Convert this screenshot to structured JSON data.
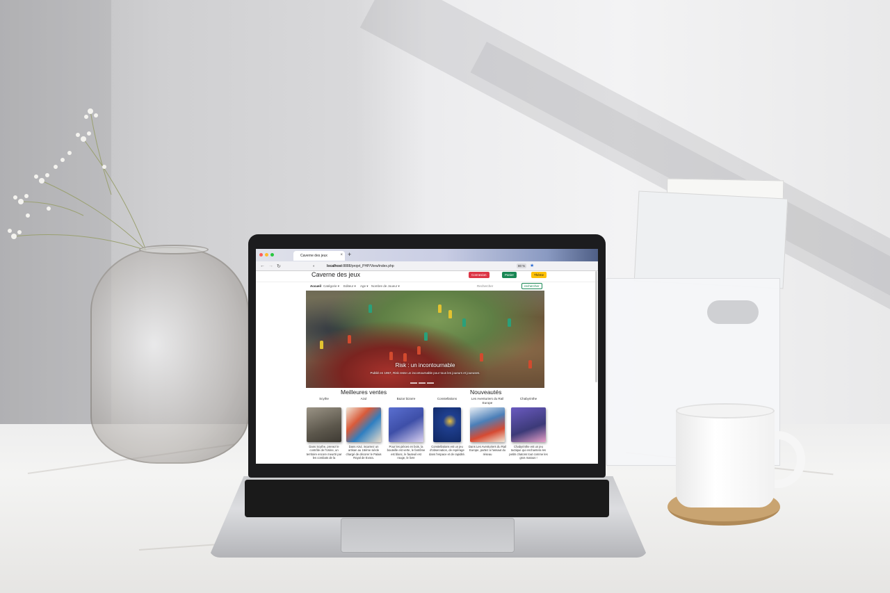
{
  "browser": {
    "tab_title": "Caverne des jeux",
    "tab_close": "×",
    "tab_new": "+",
    "url_prefix": "localhost",
    "url_rest": ":8888/projet_PHP/View/index.php",
    "zoom": "80 %"
  },
  "site": {
    "brand": "Caverne des jeux",
    "buttons": {
      "login": "Connexion",
      "cart": "Panier",
      "theme": "Thème"
    },
    "nav": [
      {
        "label": "Accueil",
        "active": true
      },
      {
        "label": "Catégorie ▾"
      },
      {
        "label": "Editeur ▾"
      },
      {
        "label": "Age ▾"
      },
      {
        "label": "Nombre de Joueur ▾"
      }
    ],
    "search_placeholder": "Rechercher",
    "search_button": "rechercher"
  },
  "carousel": {
    "title": "Risk : un incontournable",
    "subtitle": "Publié en 1957, Risk reste un incontournable pour tous les joueurs et joueuses."
  },
  "sections": {
    "best_sellers": "Meilleures ventes",
    "new_arrivals": "Nouveautés"
  },
  "products": [
    {
      "name": "Scythe",
      "desc": "Dans Scythe, prenez le contrôle de l'Usine, un territoire encore meurtri par les combats de la",
      "color": "#6f6a5e"
    },
    {
      "name": "Azul",
      "desc": "Dans Azul, incarnez un artisan au 16ème siècle chargé de décorer le Palais Royal de Evora.",
      "color": "#e8dccb"
    },
    {
      "name": "Bazar bizarre",
      "desc": "Pour les pièces en bois, la bouteille est verte, le fantôme est blanc, le fauteuil est rouge, le livre",
      "color": "#3e4fa8"
    },
    {
      "name": "Constellations",
      "desc": "Constellations est un jeu d'observation, de repérage dans l'espace et de rapidité.",
      "color": "#1f3f8f"
    },
    {
      "name": "Les Aventuriers du Rail Europe",
      "desc": "Dans Les Aventuriers du Rail Europe, partez à l'assaut du réseau",
      "color": "#4b7fb8"
    },
    {
      "name": "Chabyrinthe",
      "desc": "Chabyrinthe est un jeu tactique qui enchantera les petits chatons tout comme les gros matous !",
      "color": "#3c3a78"
    }
  ],
  "colors": {
    "danger": "#dc3545",
    "success": "#198754",
    "warning": "#ffc107"
  }
}
